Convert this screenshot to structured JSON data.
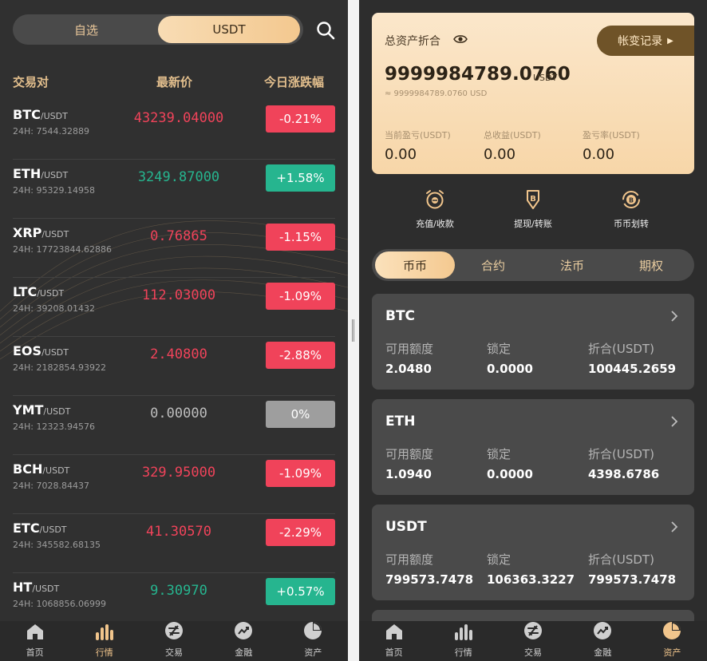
{
  "left": {
    "segments": [
      "自选",
      "USDT"
    ],
    "headers": {
      "pair": "交易对",
      "price": "最新价",
      "change": "今日涨跌幅"
    },
    "rows": [
      {
        "base": "BTC",
        "quote": "/USDT",
        "vol": "24H: 7544.32889",
        "price": "43239.04000",
        "change": "-0.21%",
        "dir": "down"
      },
      {
        "base": "ETH",
        "quote": "/USDT",
        "vol": "24H: 95329.14958",
        "price": "3249.87000",
        "change": "+1.58%",
        "dir": "up"
      },
      {
        "base": "XRP",
        "quote": "/USDT",
        "vol": "24H: 17723844.62886",
        "price": "0.76865",
        "change": "-1.15%",
        "dir": "down"
      },
      {
        "base": "LTC",
        "quote": "/USDT",
        "vol": "24H: 39208.01432",
        "price": "112.03000",
        "change": "-1.09%",
        "dir": "down"
      },
      {
        "base": "EOS",
        "quote": "/USDT",
        "vol": "24H: 2182854.93922",
        "price": "2.40800",
        "change": "-2.88%",
        "dir": "down"
      },
      {
        "base": "YMT",
        "quote": "/USDT",
        "vol": "24H: 12323.94576",
        "price": "0.00000",
        "change": "0%",
        "dir": "flat"
      },
      {
        "base": "BCH",
        "quote": "/USDT",
        "vol": "24H: 7028.84437",
        "price": "329.95000",
        "change": "-1.09%",
        "dir": "down"
      },
      {
        "base": "ETC",
        "quote": "/USDT",
        "vol": "24H: 345582.68135",
        "price": "41.30570",
        "change": "-2.29%",
        "dir": "down"
      },
      {
        "base": "HT",
        "quote": "/USDT",
        "vol": "24H: 1068856.06999",
        "price": "9.30970",
        "change": "+0.57%",
        "dir": "up"
      }
    ],
    "tabs": [
      "首页",
      "行情",
      "交易",
      "金融",
      "资产"
    ],
    "active_tab": "行情"
  },
  "right": {
    "total_label": "总资产折合",
    "record_btn": "帐变记录",
    "total_value": "9999984789.0760",
    "total_unit": "USDT",
    "approx": "≈ 9999984789.0760 USD",
    "stats": [
      {
        "k": "当前盈亏(USDT)",
        "v": "0.00"
      },
      {
        "k": "总收益(USDT)",
        "v": "0.00"
      },
      {
        "k": "盈亏率(USDT)",
        "v": "0.00"
      }
    ],
    "actions": [
      "充值/收款",
      "提现/转账",
      "币币划转"
    ],
    "segments": [
      "币币",
      "合约",
      "法币",
      "期权"
    ],
    "accounts": [
      {
        "name": "BTC",
        "available": "2.0480",
        "locked": "0.0000",
        "worth": "100445.2659"
      },
      {
        "name": "ETH",
        "available": "1.0940",
        "locked": "0.0000",
        "worth": "4398.6786"
      },
      {
        "name": "USDT",
        "available": "799573.7478",
        "locked": "106363.3227",
        "worth": "799573.7478"
      }
    ],
    "col_labels": {
      "available": "可用额度",
      "locked": "锁定",
      "worth": "折合(USDT)"
    },
    "tabs": [
      "首页",
      "行情",
      "交易",
      "金融",
      "资产"
    ],
    "active_tab": "资产"
  },
  "colors": {
    "up": "#26b58f",
    "down": "#f0435a",
    "flat": "#9e9e9e",
    "accent": "#f1c58c"
  }
}
